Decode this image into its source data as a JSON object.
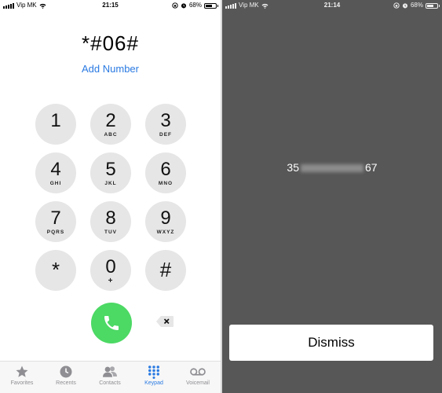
{
  "left_screen": {
    "status": {
      "carrier": "Vip MK",
      "time": "21:15",
      "battery": "68%"
    },
    "dialed_number": "*#06#",
    "add_number": "Add Number",
    "keys": [
      {
        "digit": "1",
        "letters": ""
      },
      {
        "digit": "2",
        "letters": "ABC"
      },
      {
        "digit": "3",
        "letters": "DEF"
      },
      {
        "digit": "4",
        "letters": "GHI"
      },
      {
        "digit": "5",
        "letters": "JKL"
      },
      {
        "digit": "6",
        "letters": "MNO"
      },
      {
        "digit": "7",
        "letters": "PQRS"
      },
      {
        "digit": "8",
        "letters": "TUV"
      },
      {
        "digit": "9",
        "letters": "WXYZ"
      },
      {
        "digit": "*",
        "letters": ""
      },
      {
        "digit": "0",
        "letters": "+"
      },
      {
        "digit": "#",
        "letters": ""
      }
    ],
    "tabs": [
      {
        "label": "Favorites",
        "icon": "star-icon"
      },
      {
        "label": "Recents",
        "icon": "clock-icon"
      },
      {
        "label": "Contacts",
        "icon": "contacts-icon"
      },
      {
        "label": "Keypad",
        "icon": "keypad-icon",
        "active": true
      },
      {
        "label": "Voicemail",
        "icon": "voicemail-icon"
      }
    ],
    "accent_color": "#2a7ae2",
    "call_color": "#4cd964"
  },
  "right_screen": {
    "status": {
      "carrier": "Vip MK",
      "time": "21:14",
      "battery": "68%"
    },
    "imei_prefix": "35",
    "imei_suffix": "67",
    "dismiss_label": "Dismiss",
    "background_color": "#575757"
  }
}
